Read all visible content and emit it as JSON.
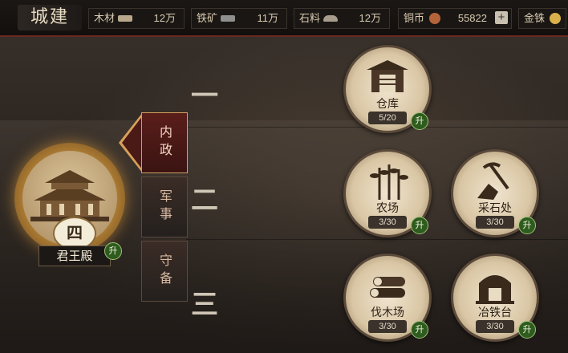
{
  "header": {
    "title": "城建",
    "resources": [
      {
        "label": "木材",
        "icon": "wood-log-icon",
        "value": "12万"
      },
      {
        "label": "铁矿",
        "icon": "iron-ore-icon",
        "value": "11万"
      },
      {
        "label": "石料",
        "icon": "stone-icon",
        "value": "12万"
      },
      {
        "label": "铜币",
        "icon": "copper-coin-icon",
        "value": "55822"
      },
      {
        "label": "金铢",
        "icon": "gold-coin-icon",
        "value": ""
      }
    ],
    "add_label": "+"
  },
  "rows": [
    "一",
    "二",
    "三"
  ],
  "main_building": {
    "name": "君王殿",
    "level": "四",
    "upgrade": "升"
  },
  "tabs": [
    {
      "label": "内政",
      "active": true
    },
    {
      "label": "军事",
      "active": false
    },
    {
      "label": "守备",
      "active": false
    }
  ],
  "buildings": [
    {
      "name": "仓库",
      "count": "5/20",
      "icon": "warehouse-icon",
      "upgrade": "升"
    },
    {
      "name": "农场",
      "count": "3/30",
      "icon": "farm-crop-icon",
      "upgrade": "升"
    },
    {
      "name": "采石处",
      "count": "3/30",
      "icon": "pickaxe-icon",
      "upgrade": "升"
    },
    {
      "name": "伐木场",
      "count": "3/30",
      "icon": "lumber-icon",
      "upgrade": "升"
    },
    {
      "name": "冶铁台",
      "count": "3/30",
      "icon": "furnace-icon",
      "upgrade": "升"
    }
  ]
}
